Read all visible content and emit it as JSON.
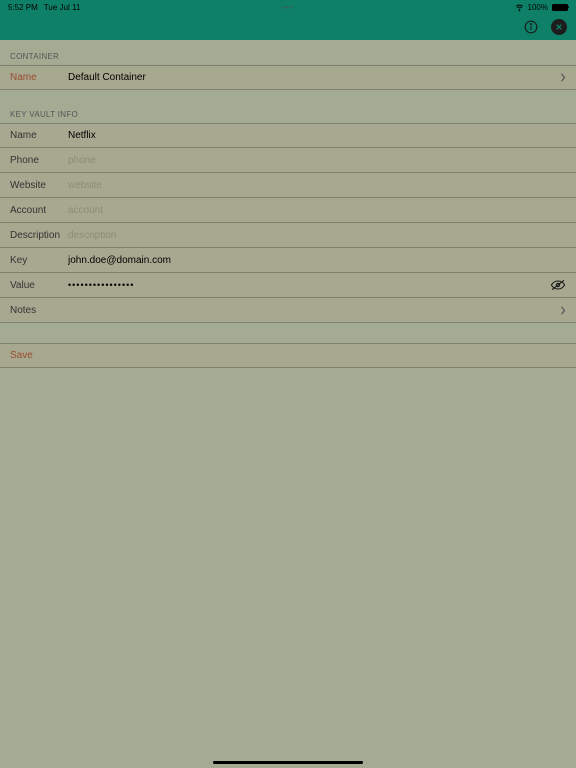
{
  "status": {
    "time": "5:52 PM",
    "date": "Tue Jul 11",
    "center_dots": "•••",
    "battery_pct": "100%"
  },
  "sections": {
    "container": {
      "header": "CONTAINER",
      "name_label": "Name",
      "name_value": "Default Container"
    },
    "vault": {
      "header": "KEY VAULT INFO",
      "name_label": "Name",
      "name_value": "Netflix",
      "phone_label": "Phone",
      "phone_placeholder": "phone",
      "phone_value": "",
      "website_label": "Website",
      "website_placeholder": "website",
      "website_value": "",
      "account_label": "Account",
      "account_placeholder": "account",
      "account_value": "",
      "description_label": "Description",
      "description_placeholder": "description",
      "description_value": "",
      "key_label": "Key",
      "key_value": "john.doe@domain.com",
      "value_label": "Value",
      "value_value": "••••••••••••••••",
      "notes_label": "Notes"
    }
  },
  "actions": {
    "save_label": "Save"
  }
}
